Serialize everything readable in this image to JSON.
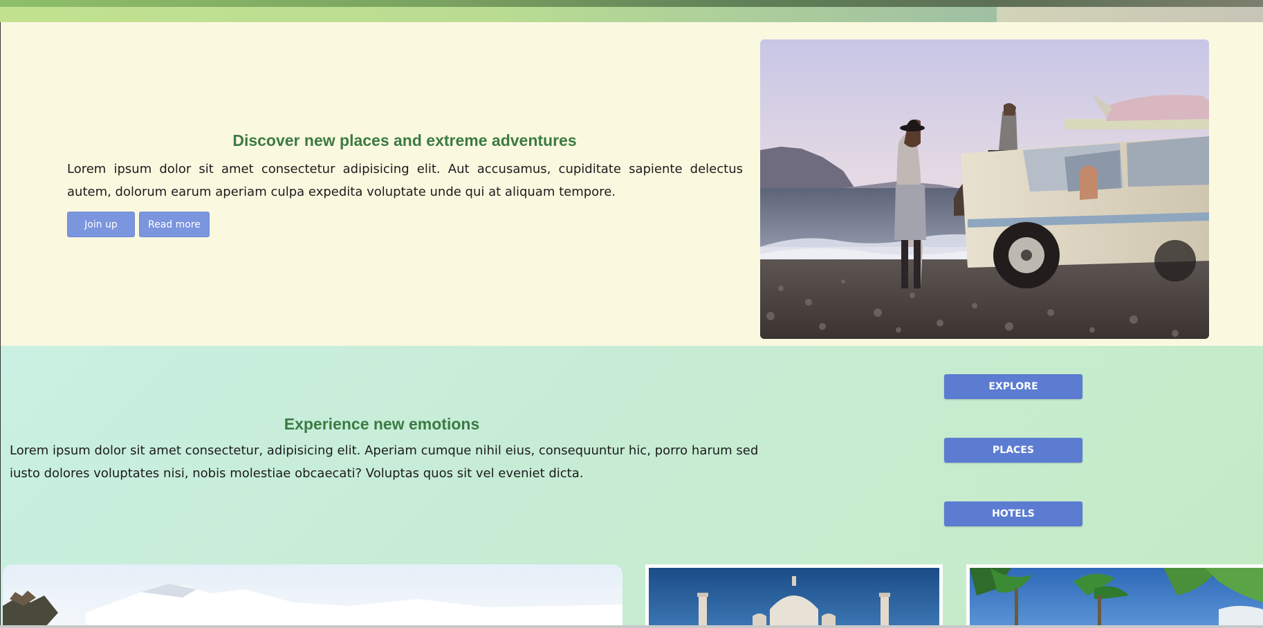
{
  "hero": {
    "heading": "Discover new places and extreme adventures",
    "text": "Lorem ipsum dolor sit amet consectetur adipisicing elit. Aut accusamus, cupiditate sapiente delectus autem, dolorum earum aperiam culpa expedita voluptate unde qui at aliquam tempore.",
    "buttons": {
      "join": "Join up",
      "read_more": "Read more"
    },
    "photo_icon": "beach-road-trip-photo"
  },
  "emotions": {
    "heading": "Experience new emotions",
    "text": "Lorem ipsum dolor sit amet consectetur, adipisicing elit. Aperiam cumque nihil eius, consequuntur hic, porro harum sed iusto dolores voluptates nisi, nobis molestiae obcaecati? Voluptas quos sit vel eveniet dicta.",
    "nav": [
      "EXPLORE",
      "PLACES",
      "HOTELS"
    ]
  },
  "cards": [
    "mountain-photo",
    "taj-mahal-photo",
    "palm-trees-photo"
  ],
  "colors": {
    "accent_green": "#3b7b42",
    "button_soft": "#7b95de",
    "button_strong": "#5b7cd1",
    "hero_bg": "#fbf8e0"
  }
}
